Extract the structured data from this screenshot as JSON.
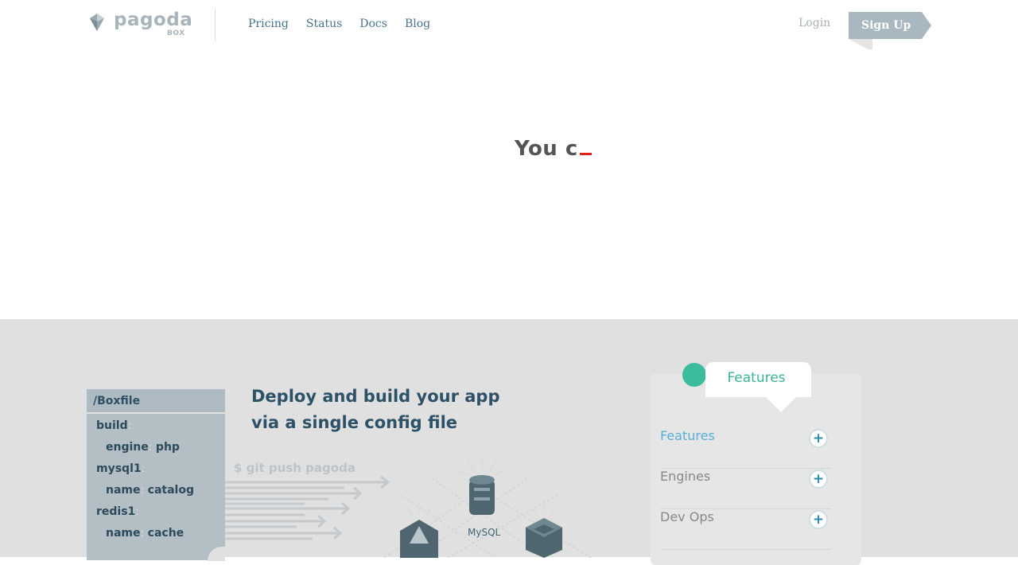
{
  "brand": {
    "logo_text": "pagoda",
    "logo_sub": "BOX",
    "accent": "#3bb39a"
  },
  "nav": {
    "items": [
      {
        "label": "Pricing"
      },
      {
        "label": "Status"
      },
      {
        "label": "Docs"
      },
      {
        "label": "Blog"
      }
    ],
    "login_label": "Login",
    "signup_label": "Sign Up"
  },
  "hero": {
    "typing_text": "You c"
  },
  "boxfile": {
    "title": "/Boxfile",
    "lines": [
      {
        "key": "build",
        "value": ""
      },
      {
        "key": "engine",
        "value": "php"
      },
      {
        "key": "mysql1",
        "value": ""
      },
      {
        "key": "name",
        "value": "catalog"
      },
      {
        "key": "redis1",
        "value": ""
      },
      {
        "key": "name",
        "value": "cache"
      }
    ]
  },
  "deploy": {
    "title_line1": "Deploy and build your app",
    "title_line2": "via a single config file",
    "command": "$ git push pagoda",
    "service_label": "MySQL"
  },
  "features": {
    "tab_label": "Features",
    "items": [
      {
        "label": "Features",
        "active": true
      },
      {
        "label": "Engines",
        "active": false
      },
      {
        "label": "Dev Ops",
        "active": false
      }
    ],
    "plus_symbol": "+"
  }
}
